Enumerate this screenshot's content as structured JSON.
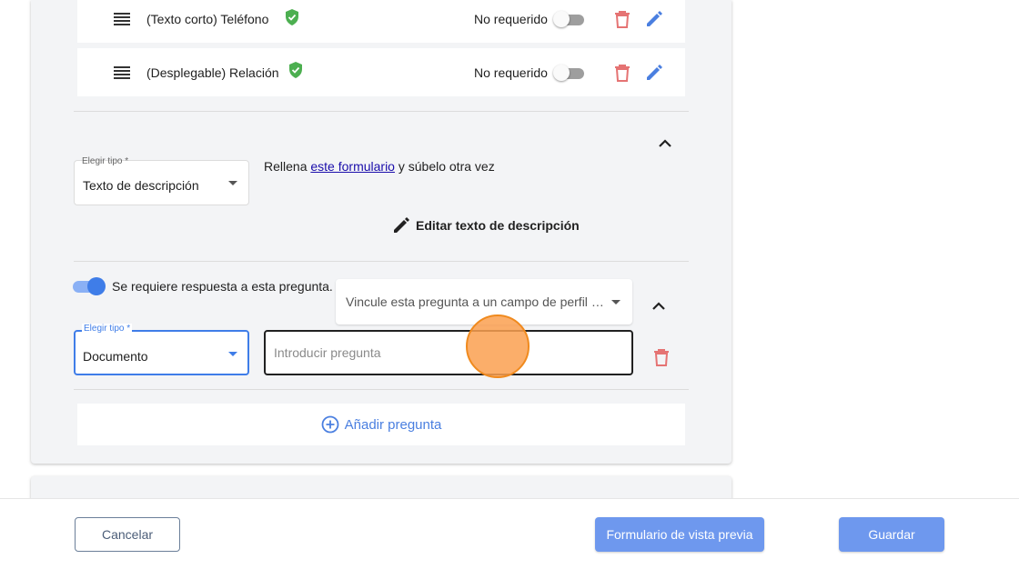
{
  "questions": [
    {
      "label": "(Texto corto) Teléfono",
      "required_label": "No requerido"
    },
    {
      "label": "(Desplegable) Relación",
      "required_label": "No requerido"
    }
  ],
  "description_block": {
    "type_label": "Elegir tipo *",
    "type_value": "Texto de descripción",
    "text_before": "Rellena ",
    "link_text": "este formulario",
    "text_after": " y súbelo otra vez",
    "edit_label": "Editar texto de descripción"
  },
  "new_question": {
    "required_toggle_label": "Se requiere respuesta a esta pregunta.",
    "profile_link_placeholder": "Vincule esta pregunta a un campo de perfil de ...",
    "type_label": "Elegir tipo *",
    "type_value": "Documento",
    "question_placeholder": "Introducir pregunta"
  },
  "add_question_label": "Añadir pregunta",
  "footer": {
    "cancel_label": "Cancelar",
    "preview_label": "Formulario de vista previa",
    "save_label": "Guardar"
  },
  "colors": {
    "accent": "#3f7de8",
    "primary_button": "#6e98ee",
    "success": "#4caf50",
    "danger": "#e57373",
    "cursor_highlight": "#f08a1e"
  },
  "icons": [
    "drag-handle-icon",
    "verified-check-icon",
    "trash-icon",
    "pencil-icon",
    "chevron-up-icon",
    "caret-down-icon",
    "add-circle-icon"
  ]
}
